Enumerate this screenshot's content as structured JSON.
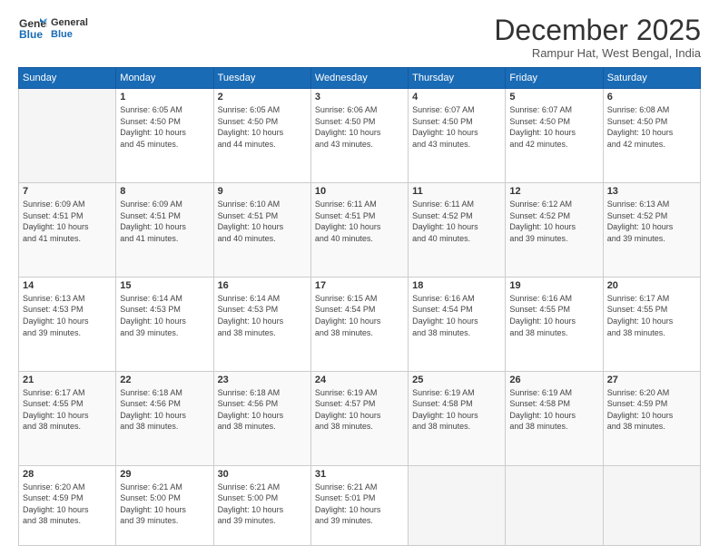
{
  "logo": {
    "line1": "General",
    "line2": "Blue"
  },
  "title": "December 2025",
  "location": "Rampur Hat, West Bengal, India",
  "weekdays": [
    "Sunday",
    "Monday",
    "Tuesday",
    "Wednesday",
    "Thursday",
    "Friday",
    "Saturday"
  ],
  "weeks": [
    [
      {
        "day": "",
        "info": ""
      },
      {
        "day": "1",
        "info": "Sunrise: 6:05 AM\nSunset: 4:50 PM\nDaylight: 10 hours\nand 45 minutes."
      },
      {
        "day": "2",
        "info": "Sunrise: 6:05 AM\nSunset: 4:50 PM\nDaylight: 10 hours\nand 44 minutes."
      },
      {
        "day": "3",
        "info": "Sunrise: 6:06 AM\nSunset: 4:50 PM\nDaylight: 10 hours\nand 43 minutes."
      },
      {
        "day": "4",
        "info": "Sunrise: 6:07 AM\nSunset: 4:50 PM\nDaylight: 10 hours\nand 43 minutes."
      },
      {
        "day": "5",
        "info": "Sunrise: 6:07 AM\nSunset: 4:50 PM\nDaylight: 10 hours\nand 42 minutes."
      },
      {
        "day": "6",
        "info": "Sunrise: 6:08 AM\nSunset: 4:50 PM\nDaylight: 10 hours\nand 42 minutes."
      }
    ],
    [
      {
        "day": "7",
        "info": "Sunrise: 6:09 AM\nSunset: 4:51 PM\nDaylight: 10 hours\nand 41 minutes."
      },
      {
        "day": "8",
        "info": "Sunrise: 6:09 AM\nSunset: 4:51 PM\nDaylight: 10 hours\nand 41 minutes."
      },
      {
        "day": "9",
        "info": "Sunrise: 6:10 AM\nSunset: 4:51 PM\nDaylight: 10 hours\nand 40 minutes."
      },
      {
        "day": "10",
        "info": "Sunrise: 6:11 AM\nSunset: 4:51 PM\nDaylight: 10 hours\nand 40 minutes."
      },
      {
        "day": "11",
        "info": "Sunrise: 6:11 AM\nSunset: 4:52 PM\nDaylight: 10 hours\nand 40 minutes."
      },
      {
        "day": "12",
        "info": "Sunrise: 6:12 AM\nSunset: 4:52 PM\nDaylight: 10 hours\nand 39 minutes."
      },
      {
        "day": "13",
        "info": "Sunrise: 6:13 AM\nSunset: 4:52 PM\nDaylight: 10 hours\nand 39 minutes."
      }
    ],
    [
      {
        "day": "14",
        "info": "Sunrise: 6:13 AM\nSunset: 4:53 PM\nDaylight: 10 hours\nand 39 minutes."
      },
      {
        "day": "15",
        "info": "Sunrise: 6:14 AM\nSunset: 4:53 PM\nDaylight: 10 hours\nand 39 minutes."
      },
      {
        "day": "16",
        "info": "Sunrise: 6:14 AM\nSunset: 4:53 PM\nDaylight: 10 hours\nand 38 minutes."
      },
      {
        "day": "17",
        "info": "Sunrise: 6:15 AM\nSunset: 4:54 PM\nDaylight: 10 hours\nand 38 minutes."
      },
      {
        "day": "18",
        "info": "Sunrise: 6:16 AM\nSunset: 4:54 PM\nDaylight: 10 hours\nand 38 minutes."
      },
      {
        "day": "19",
        "info": "Sunrise: 6:16 AM\nSunset: 4:55 PM\nDaylight: 10 hours\nand 38 minutes."
      },
      {
        "day": "20",
        "info": "Sunrise: 6:17 AM\nSunset: 4:55 PM\nDaylight: 10 hours\nand 38 minutes."
      }
    ],
    [
      {
        "day": "21",
        "info": "Sunrise: 6:17 AM\nSunset: 4:55 PM\nDaylight: 10 hours\nand 38 minutes."
      },
      {
        "day": "22",
        "info": "Sunrise: 6:18 AM\nSunset: 4:56 PM\nDaylight: 10 hours\nand 38 minutes."
      },
      {
        "day": "23",
        "info": "Sunrise: 6:18 AM\nSunset: 4:56 PM\nDaylight: 10 hours\nand 38 minutes."
      },
      {
        "day": "24",
        "info": "Sunrise: 6:19 AM\nSunset: 4:57 PM\nDaylight: 10 hours\nand 38 minutes."
      },
      {
        "day": "25",
        "info": "Sunrise: 6:19 AM\nSunset: 4:58 PM\nDaylight: 10 hours\nand 38 minutes."
      },
      {
        "day": "26",
        "info": "Sunrise: 6:19 AM\nSunset: 4:58 PM\nDaylight: 10 hours\nand 38 minutes."
      },
      {
        "day": "27",
        "info": "Sunrise: 6:20 AM\nSunset: 4:59 PM\nDaylight: 10 hours\nand 38 minutes."
      }
    ],
    [
      {
        "day": "28",
        "info": "Sunrise: 6:20 AM\nSunset: 4:59 PM\nDaylight: 10 hours\nand 38 minutes."
      },
      {
        "day": "29",
        "info": "Sunrise: 6:21 AM\nSunset: 5:00 PM\nDaylight: 10 hours\nand 39 minutes."
      },
      {
        "day": "30",
        "info": "Sunrise: 6:21 AM\nSunset: 5:00 PM\nDaylight: 10 hours\nand 39 minutes."
      },
      {
        "day": "31",
        "info": "Sunrise: 6:21 AM\nSunset: 5:01 PM\nDaylight: 10 hours\nand 39 minutes."
      },
      {
        "day": "",
        "info": ""
      },
      {
        "day": "",
        "info": ""
      },
      {
        "day": "",
        "info": ""
      }
    ]
  ]
}
